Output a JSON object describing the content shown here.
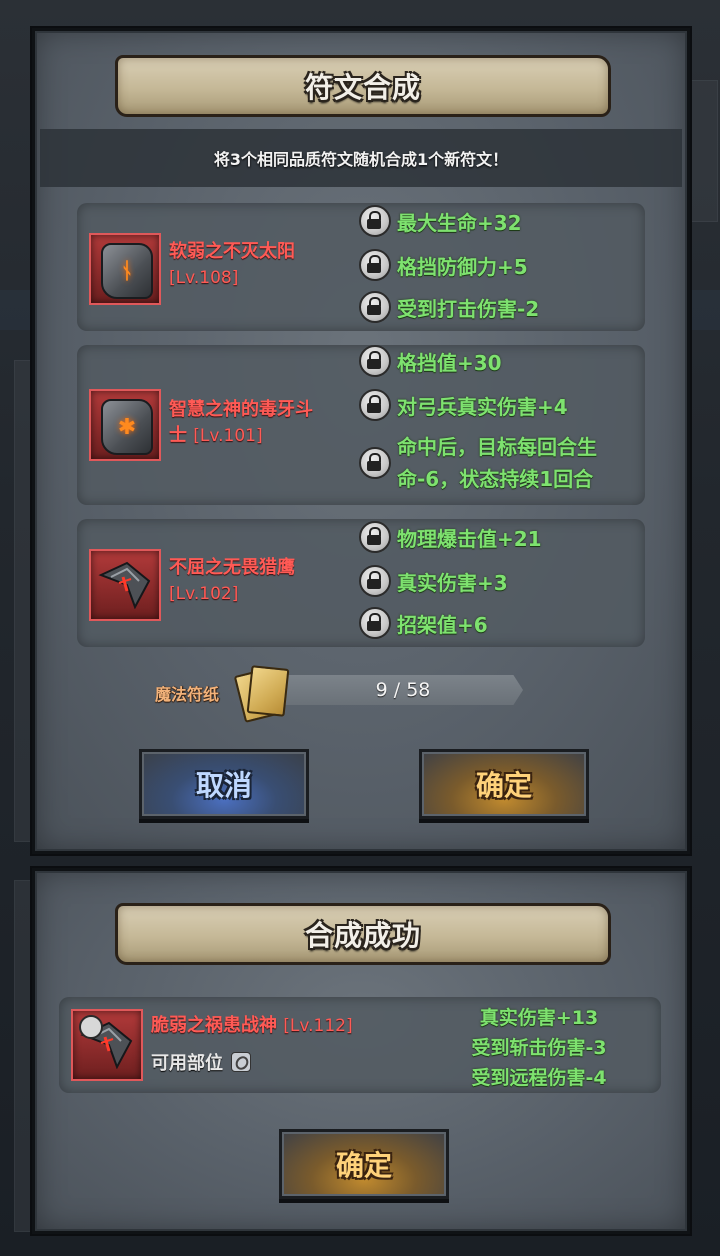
{
  "synthesis_dialog": {
    "title": "符文合成",
    "instruction": "将3个相同品质符文随机合成1个新符文！",
    "runes": [
      {
        "name": "软弱之不灭太阳",
        "level": "[Lv.108]",
        "icon": "stone-rune-icon",
        "stats": [
          "最大生命+32",
          "格挡防御力+5",
          "受到打击伤害-2"
        ]
      },
      {
        "name_line1": "智慧之神的毒牙斗",
        "name_line2_prefix": "士",
        "level": "[Lv.101]",
        "icon": "stone-rune-icon",
        "stats": [
          "格挡值+30",
          "对弓兵真实伤害+4",
          "命中后，目标每回合生",
          "命-6，状态持续1回合"
        ]
      },
      {
        "name": "不屈之无畏猎鹰",
        "level": "[Lv.102]",
        "icon": "blade-rune-icon",
        "stats": [
          "物理爆击值+21",
          "真实伤害+3",
          "招架值+6"
        ]
      }
    ],
    "material": {
      "label": "魔法符纸",
      "count": "9 / 58"
    },
    "cancel_label": "取消",
    "confirm_label": "确定"
  },
  "success_dialog": {
    "title": "合成成功",
    "rune": {
      "name": "脆弱之祸患战神",
      "level": "[Lv.112]",
      "slot_label": "可用部位",
      "stats": [
        "真实伤害+13",
        "受到斩击伤害-3",
        "受到远程伤害-4"
      ]
    },
    "confirm_label": "确定"
  },
  "colors": {
    "rune_name": "#ff5a55",
    "stat_green": "#7ee26f",
    "material_label": "#f2b27a"
  }
}
